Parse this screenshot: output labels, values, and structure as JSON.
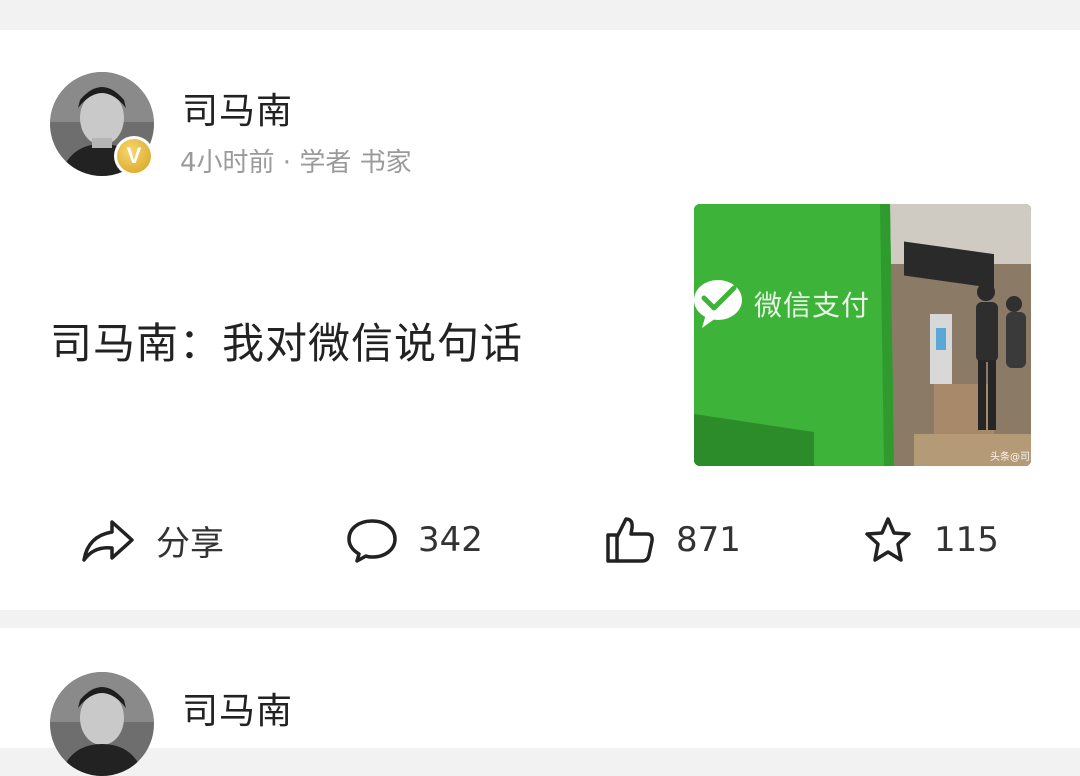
{
  "posts": [
    {
      "author": "司马南",
      "meta": "4小时前 · 学者 书家",
      "headline": "司马南：我对微信说句话",
      "thumbnail": {
        "sign_text": "微信支付",
        "watermark": "头条@司"
      },
      "actions": {
        "share_label": "分享",
        "comments": "342",
        "likes": "871",
        "favorites": "115"
      }
    },
    {
      "author": "司马南"
    }
  ],
  "colors": {
    "wechat_green": "#3aa436",
    "badge_gold": "#e0b030",
    "meta_gray": "#9a9a9a",
    "separator_bg": "#f2f2f2"
  },
  "icons": [
    "share-icon",
    "comment-icon",
    "like-icon",
    "star-icon",
    "verified-v-badge"
  ]
}
